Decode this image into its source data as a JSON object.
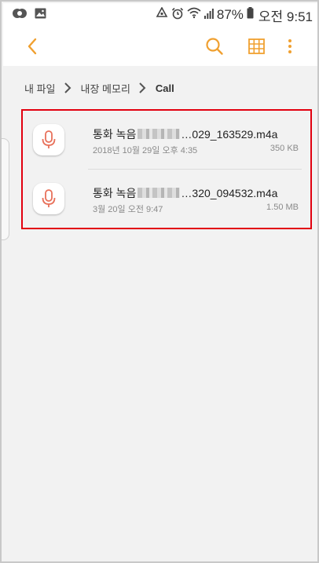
{
  "status_bar": {
    "battery_percent": "87%",
    "time": "오전 9:51",
    "icons": [
      "app-icon",
      "gallery-icon",
      "recycle-icon",
      "alarm-icon",
      "wifi-icon",
      "signal-icon",
      "battery-icon"
    ]
  },
  "action_bar": {
    "icons": [
      "back-icon",
      "search-icon",
      "grid-view-icon",
      "more-options-icon"
    ],
    "accent_color": "#f0a030"
  },
  "breadcrumb": {
    "items": [
      {
        "label": "내 파일"
      },
      {
        "label": "내장 메모리"
      },
      {
        "label": "Call"
      }
    ]
  },
  "files": [
    {
      "name_prefix": "통화 녹음",
      "name_suffix": "…029_163529.m4a",
      "date": "2018년 10월 29일 오후 4:35",
      "size": "350 KB",
      "icon": "microphone-icon"
    },
    {
      "name_prefix": "통화 녹음",
      "name_suffix": "…320_094532.m4a",
      "date": "3월 20일 오전 9:47",
      "size": "1.50 MB",
      "icon": "microphone-icon"
    }
  ],
  "colors": {
    "highlight_border": "#e2000f",
    "mic_icon": "#e8705a"
  }
}
